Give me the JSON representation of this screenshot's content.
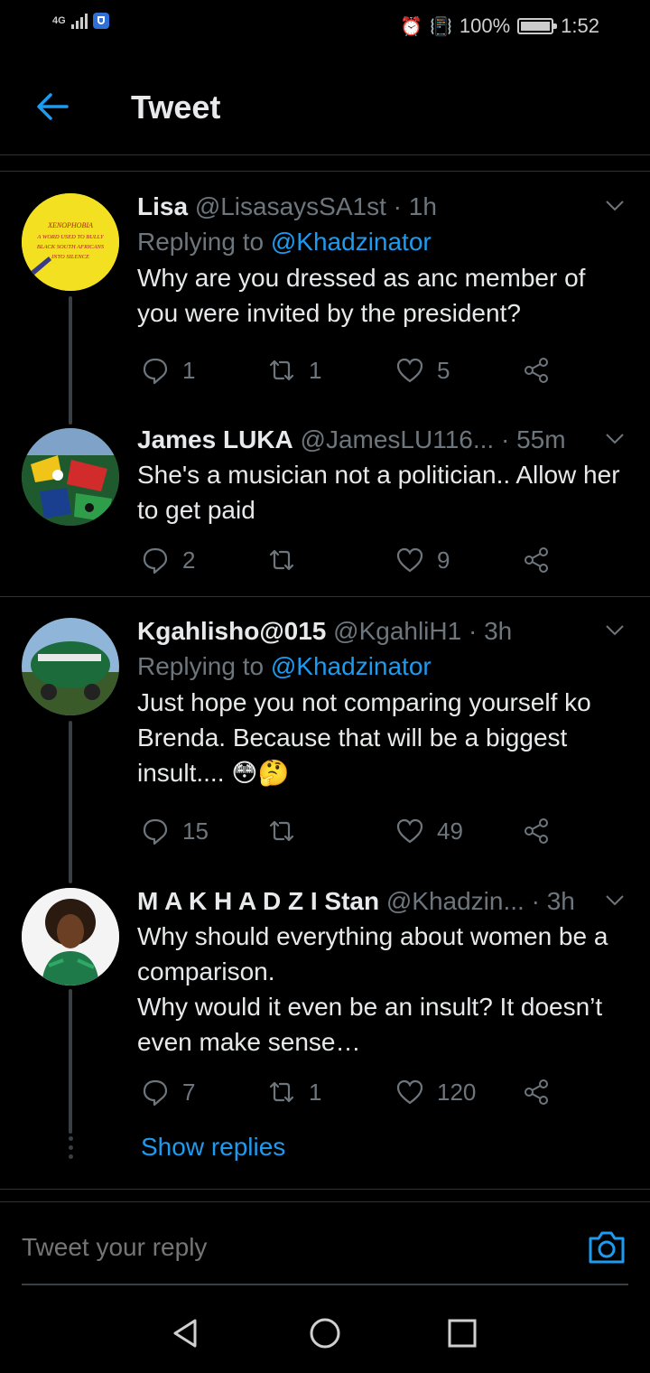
{
  "status_bar": {
    "network": "4G",
    "battery": "100%",
    "time": "1:52"
  },
  "header": {
    "title": "Tweet"
  },
  "tweets": [
    {
      "name": "Lisa",
      "handle": "@LisasaysSA1st",
      "time": "· 1h",
      "replying_prefix": "Replying to",
      "replying_to": "@Khadzinator",
      "text": "Why are you dressed as anc member of you were invited by the president?",
      "replies": "1",
      "retweets": "1",
      "likes": "5",
      "avatar_text": "XENOPHOBIA A WORD USED TO BULLY BLACK SOUTH AFRICANS INTO SILENCE"
    },
    {
      "name": "James LUKA",
      "handle": "@JamesLU116...",
      "time": "· 55m",
      "text": "She's a musician not a politician.. Allow her to get paid",
      "replies": "2",
      "retweets": "",
      "likes": "9"
    },
    {
      "name": "Kgahlisho@015",
      "handle": "@KgahliH1",
      "time": "· 3h",
      "replying_prefix": "Replying to",
      "replying_to": "@Khadzinator",
      "text": "Just hope you not comparing yourself ko Brenda. Because that will be a biggest insult.... 😳🤔",
      "replies": "15",
      "retweets": "",
      "likes": "49"
    },
    {
      "name": "M A K H A D Z I Stan",
      "handle": "@Khadzin...",
      "time": "· 3h",
      "text": "Why should everything about women be a comparison.\nWhy would it even be an insult? It doesn’t even make sense…",
      "replies": "7",
      "retweets": "1",
      "likes": "120"
    }
  ],
  "show_replies": "Show replies",
  "composer": {
    "placeholder": "Tweet your reply"
  },
  "colors": {
    "accent": "#1d9bf0",
    "background": "#000000",
    "muted": "#6e767d"
  }
}
